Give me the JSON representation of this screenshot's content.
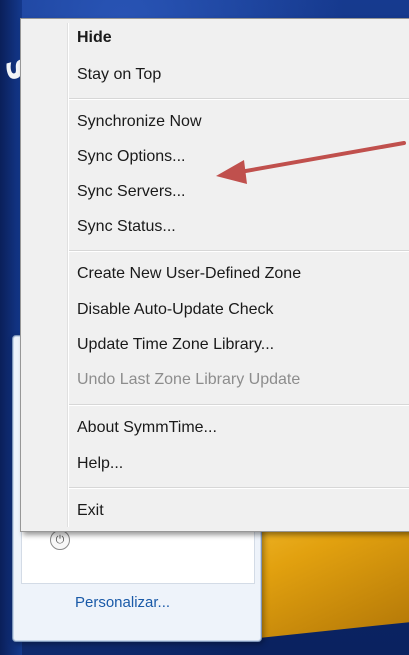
{
  "colors": {
    "menu_background": "#f0f0f0",
    "menu_text": "#1a1a1a",
    "menu_text_disabled": "#8d8d8d",
    "arrow": "#c0504d",
    "link": "#1a5aa8"
  },
  "background": {
    "link_text": "Personalizar..."
  },
  "context_menu": {
    "groups": [
      {
        "items": [
          {
            "label": "Hide",
            "bold": true,
            "enabled": true
          },
          {
            "label": "Stay on Top",
            "bold": false,
            "enabled": true
          }
        ]
      },
      {
        "items": [
          {
            "label": "Synchronize Now",
            "enabled": true
          },
          {
            "label": "Sync Options...",
            "enabled": true
          },
          {
            "label": "Sync Servers...",
            "enabled": true
          },
          {
            "label": "Sync Status...",
            "enabled": true
          }
        ]
      },
      {
        "items": [
          {
            "label": "Create New User-Defined Zone",
            "enabled": true
          },
          {
            "label": "Disable Auto-Update Check",
            "enabled": true
          },
          {
            "label": "Update Time Zone Library...",
            "enabled": true
          },
          {
            "label": "Undo Last Zone Library Update",
            "enabled": false
          }
        ]
      },
      {
        "items": [
          {
            "label": "About SymmTime...",
            "enabled": true
          },
          {
            "label": "Help...",
            "enabled": true
          }
        ]
      },
      {
        "items": [
          {
            "label": "Exit",
            "enabled": true
          }
        ]
      }
    ]
  },
  "annotation": {
    "icon": "red-arrow",
    "points_to": "Sync Options..."
  }
}
